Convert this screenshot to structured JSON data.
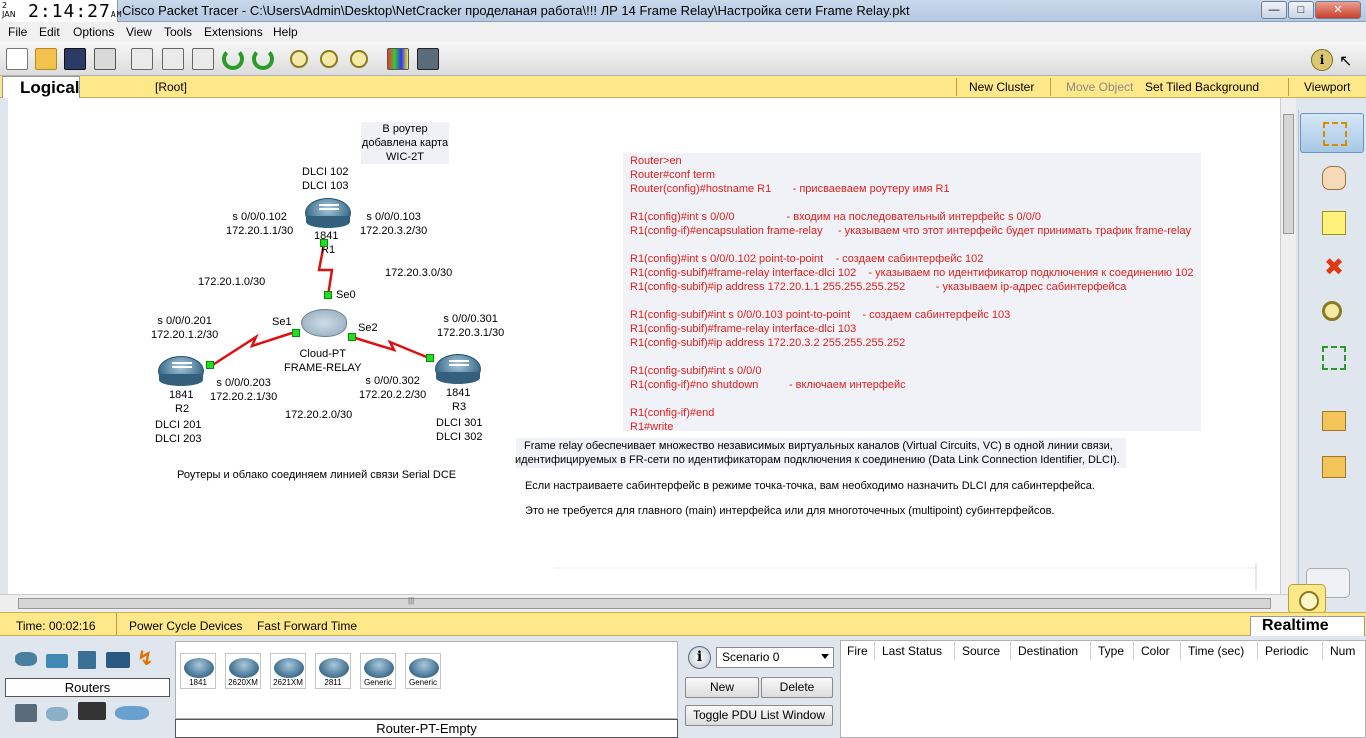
{
  "title": {
    "date_month": "2",
    "date_day": "JAN",
    "time": "2:14:27",
    "ampm": "AM",
    "text": "Cisco Packet Tracer - C:\\Users\\Admin\\Desktop\\NetCracker проделаная работа\\!!!  ЛР 14 Frame Relay\\Настройка сети Frame Relay.pkt"
  },
  "menu": [
    "File",
    "Edit",
    "Options",
    "View",
    "Tools",
    "Extensions",
    "Help"
  ],
  "logical_bar": {
    "tab": "Logical",
    "root": "[Root]",
    "new_cluster": "New Cluster",
    "move_object": "Move Object",
    "set_tiled_background": "Set Tiled Background",
    "viewport": "Viewport"
  },
  "topology": {
    "wic_note": [
      "В роутер",
      "добавлена карта",
      "WIC-2T"
    ],
    "r1_dlci": [
      "DLCI 102",
      "DLCI 103"
    ],
    "r1_left_iface": [
      "s 0/0/0.102",
      "172.20.1.1/30"
    ],
    "r1_right_iface": [
      "s 0/0/0.103",
      "172.20.3.2/30"
    ],
    "r1_model": "1841",
    "r1_name": "R1",
    "net_1": "172.20.1.0/30",
    "net_3": "172.20.3.0/30",
    "net_2": "172.20.2.0/30",
    "se0": "Se0",
    "se1": "Se1",
    "se2": "Se2",
    "cloud_name": [
      "Cloud-PT",
      "FRAME-RELAY"
    ],
    "r2_top_iface": [
      "s 0/0/0.201",
      "172.20.1.2/30"
    ],
    "r2_right_iface": [
      "s 0/0/0.203",
      "172.20.2.1/30"
    ],
    "r2_model": "1841",
    "r2_name": "R2",
    "r2_dlci": [
      "DLCI 201",
      "DLCI 203"
    ],
    "r3_top_iface": [
      "s 0/0/0.301",
      "172.20.3.1/30"
    ],
    "r3_left_iface": [
      "s 0/0/0.302",
      "172.20.2.2/30"
    ],
    "r3_model": "1841",
    "r3_name": "R3",
    "r3_dlci": [
      "DLCI 301",
      "DLCI 302"
    ],
    "bottom_note": "Роутеры и облако соединяем линией связи Serial DCE"
  },
  "config_lines": [
    "Router>en",
    "Router#conf term",
    "Router(config)#hostname R1       - присваеваем роутеру имя R1",
    "",
    "R1(config)#int s 0/0/0                 - входим на последовательный интерфейс s 0/0/0",
    "R1(config-if)#encapsulation frame-relay     - указываем что этот интерфейс будет принимать трафик frame-relay",
    "",
    "R1(config)#int s 0/0/0.102 point-to-point    - создаем сабинтерфейс 102",
    "R1(config-subif)#frame-relay interface-dlci 102    - указываем по идентификатор подключения к соединению 102",
    "R1(config-subif)#ip address 172.20.1.1 255.255.255.252          - указываем ip-адрес сабинтерфейса",
    "",
    "R1(config-subif)#int s 0/0/0.103 point-to-point    - создаем сабинтерфейс 103",
    "R1(config-subif)#frame-relay interface-dlci 103",
    "R1(config-subif)#ip address 172.20.3.2 255.255.255.252",
    "",
    "R1(config-subif)#int s 0/0/0",
    "R1(config-if)#no shutdown          - включаем интерфейс",
    "",
    "R1(config-if)#end",
    "R1#write"
  ],
  "info": {
    "line1": "Frame relay обеспечивает множество независимых виртуальных каналов (Virtual Circuits, VC) в одной линии связи,",
    "line2": "идентифицируемых в FR-сети по идентификаторам подключения к соединению (Data Link Connection Identifier, DLCI).",
    "line3": "Если настраиваете сабинтерфейс в режиме точка-точка, вам необходимо назначить DLCI для сабинтерфейса.",
    "line4": "Это не требуется для главного (main) интерфейса или для многоточечных  (multipoint) субинтерфейсов."
  },
  "status": {
    "time": "Time: 00:02:16",
    "power_cycle": "Power Cycle Devices",
    "fast_forward": "Fast Forward Time",
    "realtime": "Realtime"
  },
  "bottom": {
    "category": "Routers",
    "devices": [
      "1841",
      "2620XM",
      "2621XM",
      "2811",
      "Generic",
      "Generic"
    ],
    "device_name": "Router-PT-Empty",
    "scenario": "Scenario 0",
    "new": "New",
    "delete": "Delete",
    "toggle_pdu": "Toggle PDU List Window",
    "pdu_columns": [
      "Fire",
      "Last Status",
      "Source",
      "Destination",
      "Type",
      "Color",
      "Time (sec)",
      "Periodic",
      "Num"
    ]
  },
  "colors": {
    "link": "#dd1111",
    "port": "#22dd22",
    "config_text": "#e0201e",
    "yellow_bar": "#ffe88a"
  }
}
